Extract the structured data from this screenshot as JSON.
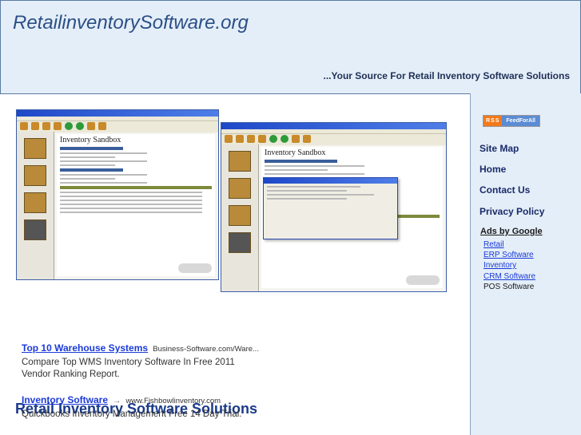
{
  "header": {
    "site_title": "RetailinventorySoftware.org",
    "tagline": "...Your Source For Retail Inventory Software Solutions"
  },
  "screenshots": {
    "left": {
      "heading": "Inventory Sandbox"
    },
    "right": {
      "heading": "Inventory Sandbox"
    }
  },
  "main": {
    "heading": "Retail Inventory Software Solutions",
    "ads": [
      {
        "title": "Top 10 Warehouse Systems",
        "url": "Business-Software.com/Ware...",
        "description": "Compare Top WMS Inventory Software In Free 2011 Vendor Ranking Report."
      },
      {
        "title": "Inventory Software",
        "url": "www.Fishbowlinventory.com",
        "description": "Quickbooks Inventory Management Free 14 Day Trial."
      }
    ]
  },
  "sidebar": {
    "rss_label": "RSS",
    "feed_label": "FeedForAll",
    "nav": [
      "Site Map",
      "Home",
      "Contact Us",
      "Privacy Policy"
    ],
    "ads_title": "Ads by Google",
    "ads_links": [
      "Retail",
      "ERP Software",
      "Inventory",
      "CRM Software",
      "POS Software"
    ]
  }
}
